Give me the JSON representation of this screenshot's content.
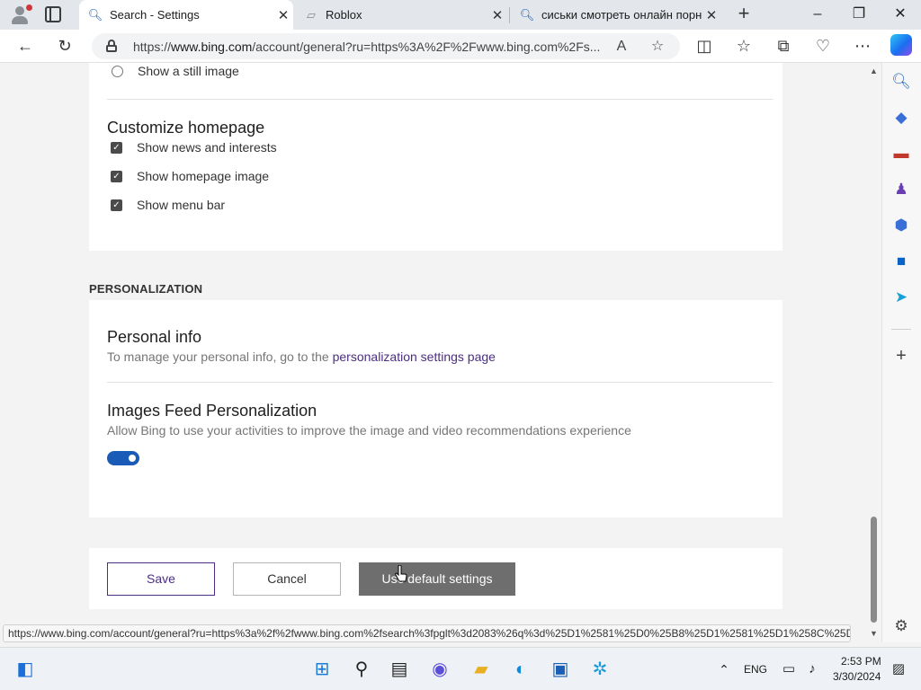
{
  "browser": {
    "tabs": [
      {
        "label": "Search - Settings",
        "active": true,
        "icon": "search-icon"
      },
      {
        "label": "Roblox",
        "active": false,
        "icon": "roblox-icon"
      },
      {
        "label": "сиськи смотреть онлайн порно",
        "active": false,
        "icon": "search-icon"
      }
    ],
    "url_prefix": "https://",
    "url_domain": "www.bing.com",
    "url_rest": "/account/general?ru=https%3A%2F%2Fwww.bing.com%2Fs...",
    "status_url": "https://www.bing.com/account/general?ru=https%3a%2f%2fwww.bing.com%2fsearch%3fpglt%3d2083%26q%3d%25D1%2581%25D0%25B8%25D1%2581%25D1%258C%25D..."
  },
  "page": {
    "still_image_label": "Show a still image",
    "customize_heading": "Customize homepage",
    "checkboxes": [
      {
        "label": "Show news and interests",
        "checked": true
      },
      {
        "label": "Show homepage image",
        "checked": true
      },
      {
        "label": "Show menu bar",
        "checked": true
      }
    ],
    "personalization_title": "PERSONALIZATION",
    "personal_info_heading": "Personal info",
    "personal_info_desc": "To manage your personal info, go to the",
    "personal_info_link": "personalization settings page",
    "images_feed_heading": "Images Feed Personalization",
    "images_feed_desc": "Allow Bing to use your activities to improve the image and video recommendations experience",
    "images_feed_toggle_on": true,
    "save_label": "Save",
    "cancel_label": "Cancel",
    "defaults_label": "Use default settings"
  },
  "taskbar": {
    "lang": "ENG",
    "time": "2:53 PM",
    "date": "3/30/2024"
  },
  "colors": {
    "accent": "#1a5bb8",
    "link": "#4b2e83"
  }
}
